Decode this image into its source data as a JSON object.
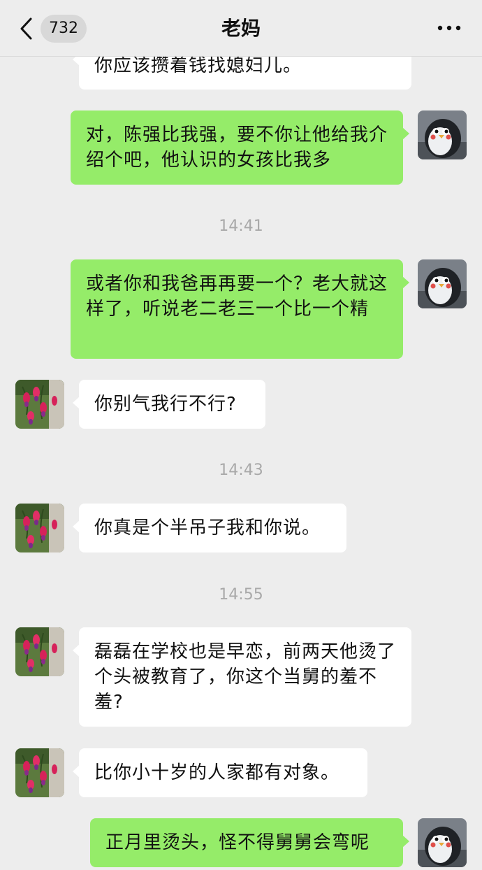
{
  "header": {
    "title": "老妈",
    "unread_count": "732"
  },
  "messages": [
    {
      "side": "in-partial",
      "text": "你应该攒着钱找媳妇儿。"
    },
    {
      "side": "out",
      "text": "对，陈强比我强，要不你让他给我介绍个吧，他认识的女孩比我多"
    },
    {
      "time": "14:41"
    },
    {
      "side": "out",
      "text": "或者你和我爸再再要一个？老大就这样了，听说老二老三一个比一个精"
    },
    {
      "side": "in",
      "text": "你别气我行不行?"
    },
    {
      "time": "14:43"
    },
    {
      "side": "in",
      "text": "你真是个半吊子我和你说。"
    },
    {
      "time": "14:55"
    },
    {
      "side": "in",
      "text": "磊磊在学校也是早恋，前两天他烫了个头被教育了，你这个当舅的羞不羞?"
    },
    {
      "side": "in",
      "text": "比你小十岁的人家都有对象。"
    },
    {
      "side": "out",
      "text": "正月里烫头，怪不得舅舅会弯呢"
    }
  ],
  "colors": {
    "background": "#ededed",
    "incoming": "#ffffff",
    "outgoing": "#95ec69",
    "timestamp": "#a9a9a9"
  },
  "icons": {
    "back": "chevron-left-icon",
    "more": "more-dots-icon",
    "self_avatar": "penguin-avatar",
    "mom_avatar": "fuchsia-flower-avatar"
  }
}
